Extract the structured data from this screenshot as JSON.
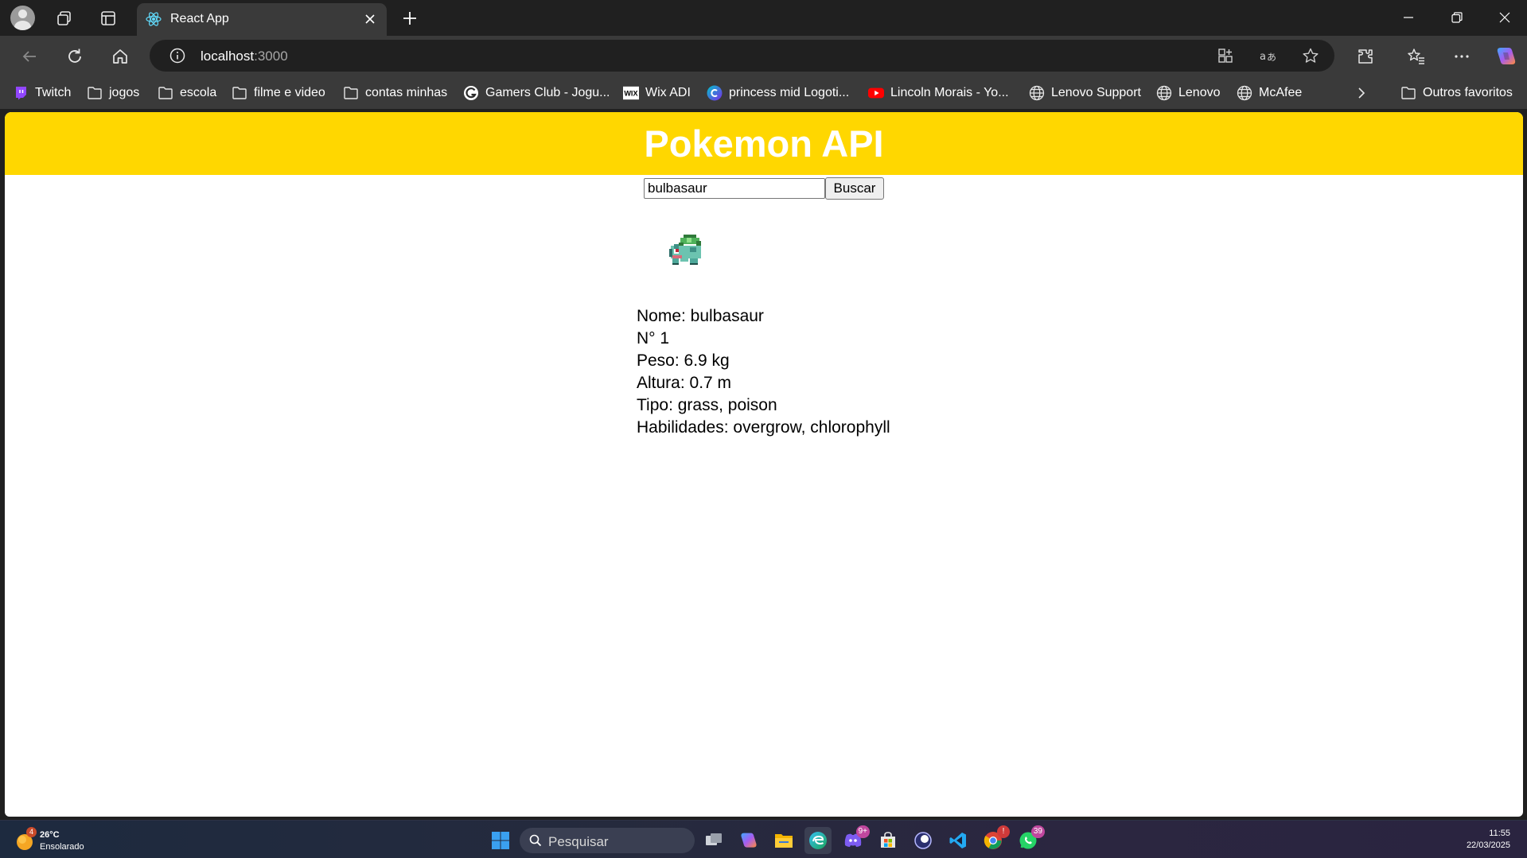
{
  "browser": {
    "tab": {
      "title": "React App",
      "favicon": "react-icon"
    },
    "address": {
      "host": "localhost",
      "port": ":3000"
    },
    "bookmarks": [
      {
        "label": "Twitch",
        "icon": "twitch-icon"
      },
      {
        "label": "jogos",
        "icon": "folder-icon"
      },
      {
        "label": "escola",
        "icon": "folder-icon"
      },
      {
        "label": "filme e video",
        "icon": "folder-icon"
      },
      {
        "label": "contas minhas",
        "icon": "folder-icon"
      },
      {
        "label": "Gamers Club - Jogu...",
        "icon": "gamersclub-icon"
      },
      {
        "label": "Wix ADI",
        "icon": "wix-icon"
      },
      {
        "label": "princess mid Logoti...",
        "icon": "canva-icon"
      },
      {
        "label": "Lincoln Morais - Yo...",
        "icon": "youtube-icon"
      },
      {
        "label": "Lenovo Support",
        "icon": "globe-icon"
      },
      {
        "label": "Lenovo",
        "icon": "globe-icon"
      },
      {
        "label": "McAfee",
        "icon": "globe-icon"
      }
    ],
    "other_favorites": "Outros favoritos"
  },
  "app": {
    "title": "Pokemon API",
    "search": {
      "value": "bulbasaur",
      "button": "Buscar"
    },
    "pokemon": {
      "sprite": "bulbasaur-sprite",
      "name_line": "Nome: bulbasaur",
      "number_line": "N° 1",
      "weight_line": "Peso: 6.9 kg",
      "height_line": "Altura: 0.7 m",
      "type_line": "Tipo: grass, poison",
      "abilities_line": "Habilidades: overgrow, chlorophyll"
    }
  },
  "taskbar": {
    "weather": {
      "temp": "26°C",
      "desc": "Ensolarado",
      "badge": "4"
    },
    "search_placeholder": "Pesquisar",
    "badges": {
      "discord": "9+",
      "chrome": "!",
      "whatsapp": "39"
    },
    "clock": {
      "time": "11:55",
      "date": "22/03/2025"
    }
  },
  "colors": {
    "header": "#ffd700",
    "header_text": "#ffffff",
    "browser_dark": "#202020",
    "browser_toolbar": "#3a3a3a"
  }
}
